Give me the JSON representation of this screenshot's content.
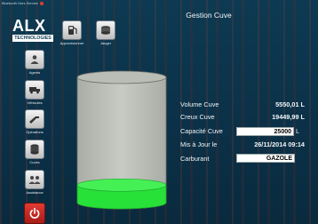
{
  "window": {
    "caption": "Bluetooth Hors Service"
  },
  "logo": {
    "name": "ALX",
    "sub": "TECHNOLOGIES"
  },
  "header": {
    "title": "Gestion Cuve"
  },
  "toolbar": [
    {
      "label": "Approvisionner",
      "icon": "fuel-pump-icon"
    },
    {
      "label": "Jauger",
      "icon": "gauge-icon"
    }
  ],
  "sidebar": {
    "items": [
      {
        "label": "Agents",
        "icon": "user-icon"
      },
      {
        "label": "Véhicules",
        "icon": "truck-icon"
      },
      {
        "label": "Opérations",
        "icon": "fuel-nozzle-icon"
      },
      {
        "label": "Cuves",
        "icon": "tank-icon"
      },
      {
        "label": "Assistance",
        "icon": "support-icon"
      }
    ],
    "power_icon": "power-icon"
  },
  "tank": {
    "fill_fraction": 0.14,
    "fill_color": "#27e038"
  },
  "info": {
    "volume_label": "Volume Cuve",
    "volume_value": "5550,01 L",
    "creux_label": "Creux Cuve",
    "creux_value": "19449,99 L",
    "capacite_label": "Capacité Cuve",
    "capacite_value": "25000",
    "capacite_unit": "L",
    "maj_label": "Mis à Jour le",
    "maj_value": "26/11/2014 09:14",
    "carburant_label": "Carburant",
    "carburant_value": "GAZOLE"
  }
}
